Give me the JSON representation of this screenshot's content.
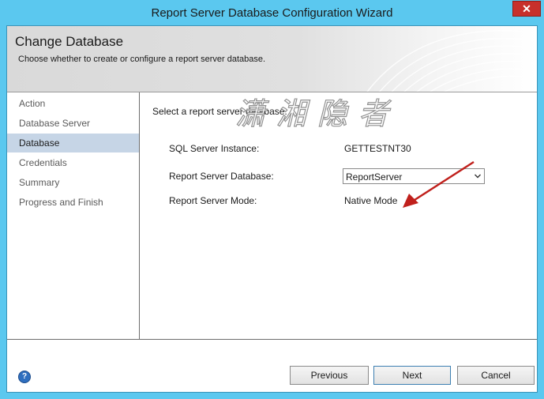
{
  "window": {
    "title": "Report Server Database Configuration Wizard",
    "close_glyph": "✕"
  },
  "banner": {
    "title": "Change Database",
    "subtitle": "Choose whether to create or configure a report server database."
  },
  "nav": {
    "items": [
      {
        "label": "Action",
        "selected": false
      },
      {
        "label": "Database Server",
        "selected": false
      },
      {
        "label": "Database",
        "selected": true
      },
      {
        "label": "Credentials",
        "selected": false
      },
      {
        "label": "Summary",
        "selected": false
      },
      {
        "label": "Progress and Finish",
        "selected": false
      }
    ]
  },
  "main": {
    "instruction": "Select a report server database:",
    "fields": {
      "instance_label": "SQL Server Instance:",
      "instance_value": "GETTESTNT30",
      "database_label": "Report Server Database:",
      "database_value": "ReportServer",
      "mode_label": "Report Server Mode:",
      "mode_value": "Native Mode"
    },
    "watermark": "潇湘隐者"
  },
  "footer": {
    "help_glyph": "?",
    "previous_label": "Previous",
    "next_label": "Next",
    "cancel_label": "Cancel"
  },
  "colors": {
    "titlebar": "#5bc8ef",
    "close": "#c7302b",
    "selected_nav": "#c6d5e6",
    "arrow": "#c0201c"
  }
}
